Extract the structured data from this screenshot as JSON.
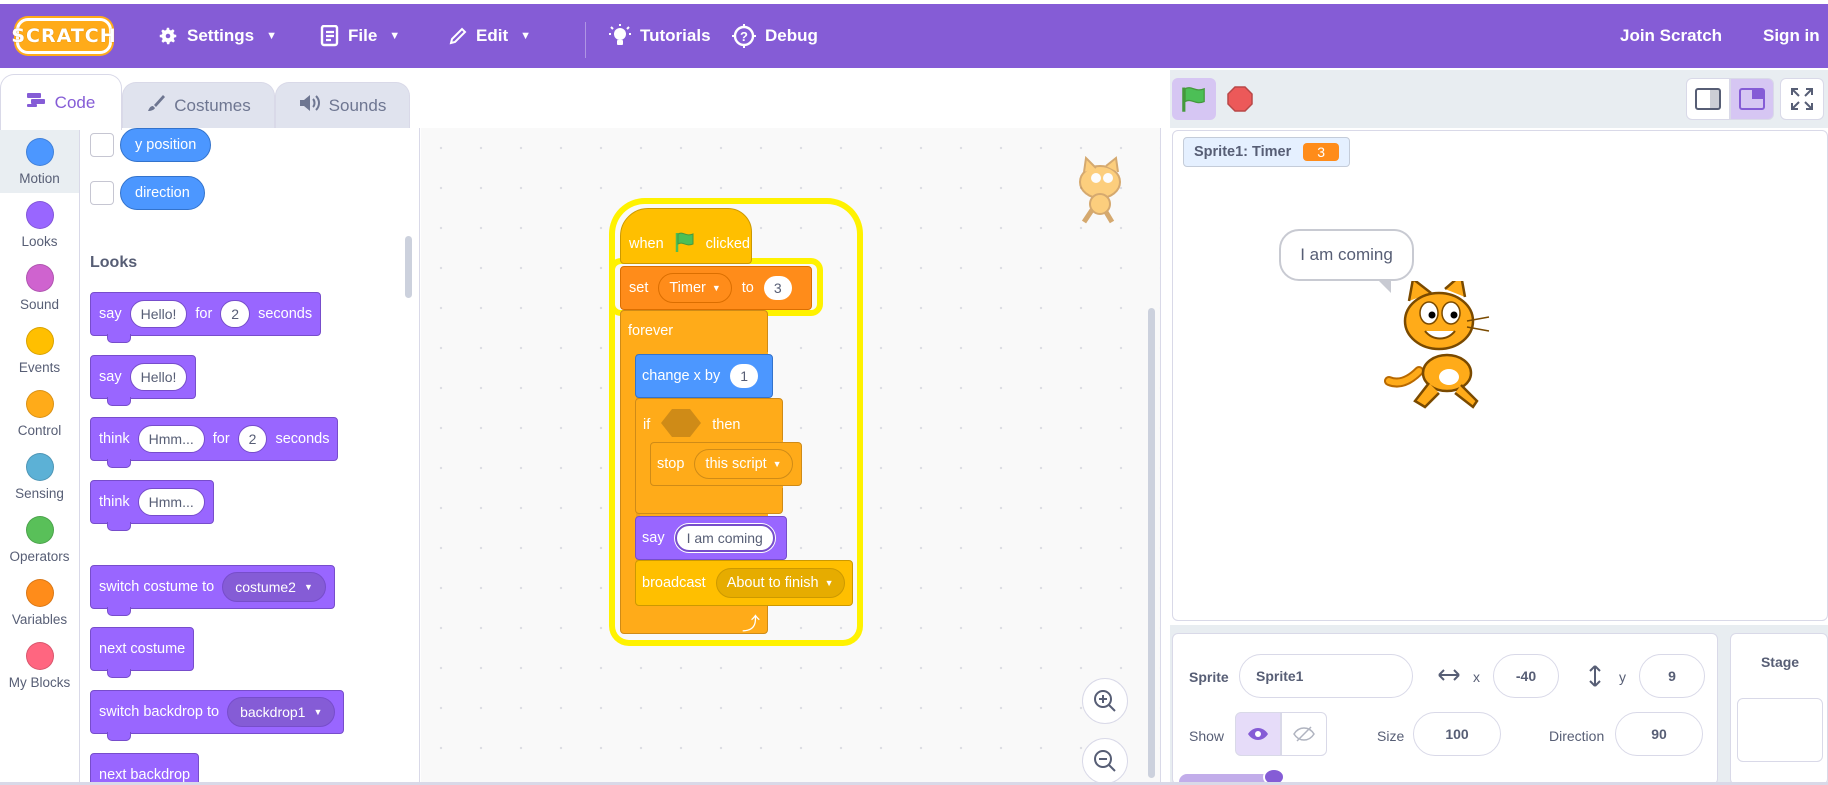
{
  "menubar": {
    "logo_text": "SCRATCH",
    "settings": "Settings",
    "file": "File",
    "edit": "Edit",
    "tutorials": "Tutorials",
    "debug": "Debug",
    "join": "Join Scratch",
    "signin": "Sign in",
    "bg_color": "#855cd6"
  },
  "tabs": {
    "code": "Code",
    "costumes": "Costumes",
    "sounds": "Sounds"
  },
  "categories": [
    {
      "label": "Motion",
      "color": "#4c97ff"
    },
    {
      "label": "Looks",
      "color": "#9966ff"
    },
    {
      "label": "Sound",
      "color": "#cf63cf"
    },
    {
      "label": "Events",
      "color": "#ffbf00"
    },
    {
      "label": "Control",
      "color": "#ffab19"
    },
    {
      "label": "Sensing",
      "color": "#5cb1d6"
    },
    {
      "label": "Operators",
      "color": "#59c059"
    },
    {
      "label": "Variables",
      "color": "#ff8c1a"
    },
    {
      "label": "My Blocks",
      "color": "#ff6680"
    }
  ],
  "palette": {
    "y_position": "y position",
    "direction": "direction",
    "looks_heading": "Looks",
    "say_for": {
      "say": "say",
      "msg": "Hello!",
      "for": "for",
      "secs": "2",
      "seconds": "seconds"
    },
    "say": {
      "say": "say",
      "msg": "Hello!"
    },
    "think_for": {
      "think": "think",
      "msg": "Hmm...",
      "for": "for",
      "secs": "2",
      "seconds": "seconds"
    },
    "think": {
      "think": "think",
      "msg": "Hmm..."
    },
    "switch_costume": {
      "label": "switch costume to",
      "value": "costume2"
    },
    "next_costume": "next costume",
    "switch_backdrop": {
      "label": "switch backdrop to",
      "value": "backdrop1"
    },
    "next_backdrop": "next backdrop"
  },
  "script": {
    "when": "when",
    "clicked": "clicked",
    "set": "set",
    "var": "Timer",
    "to": "to",
    "set_val": "3",
    "forever": "forever",
    "change_x": "change x by",
    "change_val": "1",
    "if": "if",
    "then": "then",
    "stop": "stop",
    "stop_opt": "this script",
    "say": "say",
    "say_msg": "I am coming",
    "broadcast": "broadcast",
    "broadcast_msg": "About to finish"
  },
  "stage": {
    "monitor_label": "Sprite1: Timer",
    "monitor_value": "3",
    "bubble": "I am coming"
  },
  "sprite_info": {
    "sprite_label": "Sprite",
    "sprite_name": "Sprite1",
    "x_label": "x",
    "x_val": "-40",
    "y_label": "y",
    "y_val": "9",
    "show_label": "Show",
    "size_label": "Size",
    "size_val": "100",
    "direction_label": "Direction",
    "direction_val": "90"
  },
  "stage_panel": {
    "title": "Stage"
  }
}
